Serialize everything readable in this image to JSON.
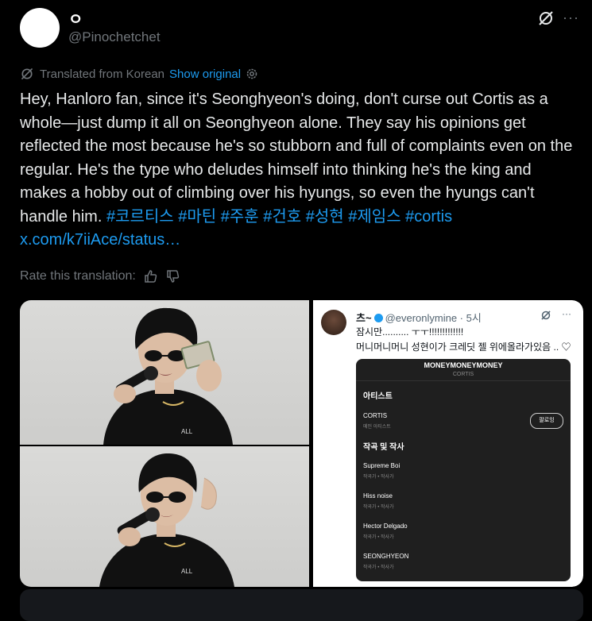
{
  "author": {
    "name": "ㅇ",
    "handle": "@Pinochetchet"
  },
  "header_icons": [
    "grok-slash-icon",
    "more-icon"
  ],
  "more_glyph": "···",
  "translation": {
    "label": "Translated from Korean",
    "show_original": "Show original"
  },
  "tweet": {
    "text": "Hey, Hanloro fan, since it's Seonghyeon's doing, don't curse out Cortis as a whole—just dump it all on Seonghyeon alone. They say his opinions get reflected the most because he's so stubborn and full of complaints even on the regular. He's the type who deludes himself into thinking he's the king and makes a hobby out of climbing over his hyungs, so even the hyungs can't handle him.",
    "hashtags": [
      "#코르티스",
      "#마틴",
      "#주훈",
      "#건호",
      "#성현",
      "#제임스",
      "#cortis"
    ],
    "link": "x.com/k7iiAce/status…"
  },
  "rate": {
    "label": "Rate this translation:"
  },
  "screenshot": {
    "name": "츠~",
    "handle": "@everonlymine · 5시",
    "line1": "잠시만.......... ㅜㅜ!!!!!!!!!!!!!",
    "line2": "머니머니머니 성현이가 크레딧 젤 위에올라가있음 .. ♡",
    "card": {
      "title": "MONEYMONEYMONEY",
      "subtitle": "CORTIS",
      "artist_head": "아티스트",
      "artist": "CORTIS",
      "artist_role": "메인 아티스트",
      "follow": "팔로잉",
      "credits_head": "작곡 및 작사",
      "credits": [
        {
          "name": "Supreme Boi",
          "role": "작곡가 • 작사가"
        },
        {
          "name": "Hiss noise",
          "role": "작곡가 • 작사가"
        },
        {
          "name": "Hector Delgado",
          "role": "작곡가 • 작사가"
        },
        {
          "name": "SEONGHYEON",
          "role": "작곡가 • 작사가"
        }
      ]
    }
  },
  "photo_shirt_text": "ALL"
}
